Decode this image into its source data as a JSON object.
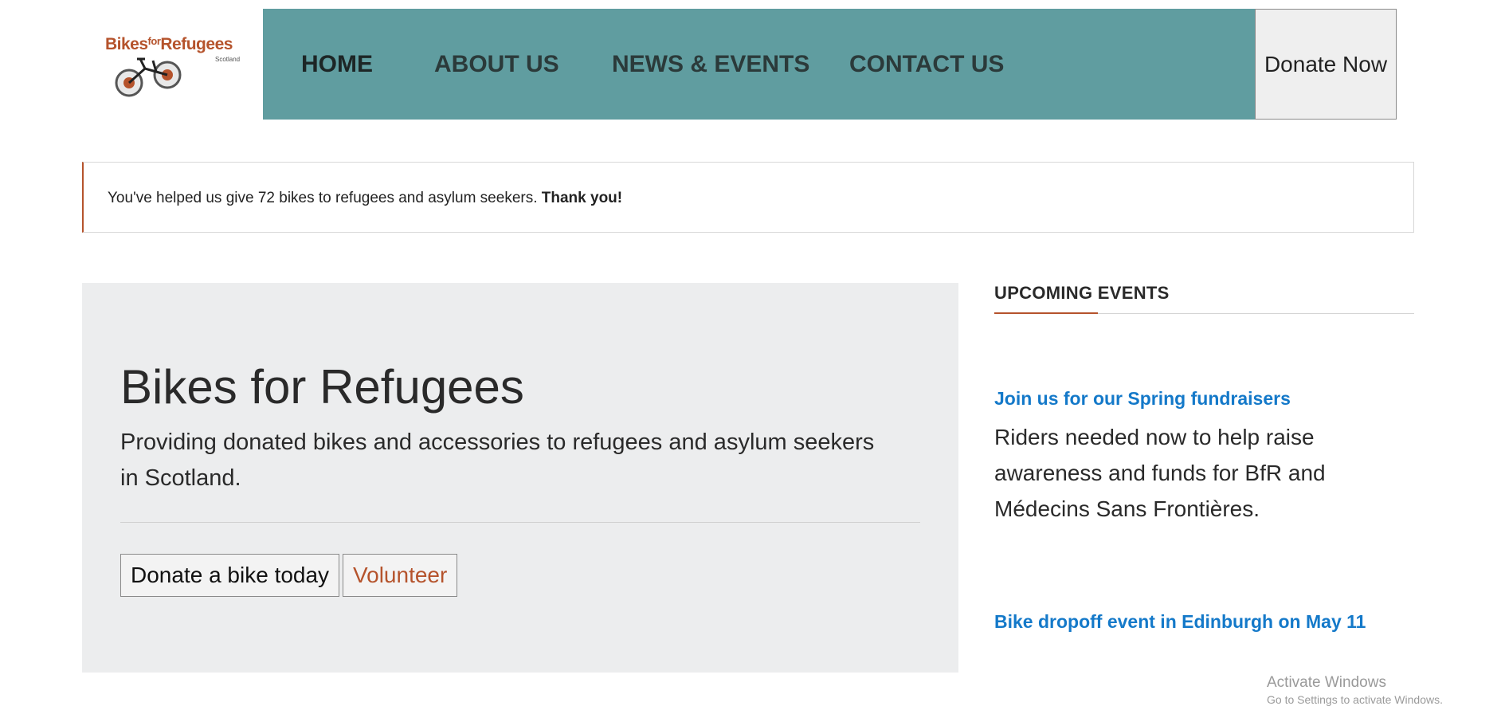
{
  "header": {
    "logo": {
      "text_bikes": "Bikes",
      "text_for": "for",
      "text_refugees": "Refugees",
      "text_region": "Scotland"
    },
    "nav": [
      {
        "label": "HOME"
      },
      {
        "label": "ABOUT US"
      },
      {
        "label": "NEWS & EVENTS"
      },
      {
        "label": "CONTACT US"
      }
    ],
    "donate_label": "Donate Now",
    "nav_color": "#609da0"
  },
  "notice": {
    "text": "You've helped us give 72 bikes to refugees and asylum seekers.",
    "emphasis": "Thank you!"
  },
  "hero": {
    "title": "Bikes for Refugees",
    "subtitle": "Providing donated bikes and accessories to refugees and asylum seekers in Scotland.",
    "buttons": {
      "donate": "Donate a bike today",
      "volunteer": "Volunteer"
    }
  },
  "events": {
    "heading": "UPCOMING EVENTS",
    "items": [
      {
        "title": "Join us for our Spring fundraisers",
        "description": "Riders needed now to help raise awareness and funds for BfR and Médecins Sans Frontières."
      },
      {
        "title": "Bike dropoff event in Edinburgh on May 11"
      }
    ]
  },
  "watermark": {
    "title": "Activate Windows",
    "subtitle": "Go to Settings to activate Windows."
  },
  "colors": {
    "accent": "#b5532c",
    "link": "#1479c9",
    "hero_bg": "#ecedee"
  }
}
